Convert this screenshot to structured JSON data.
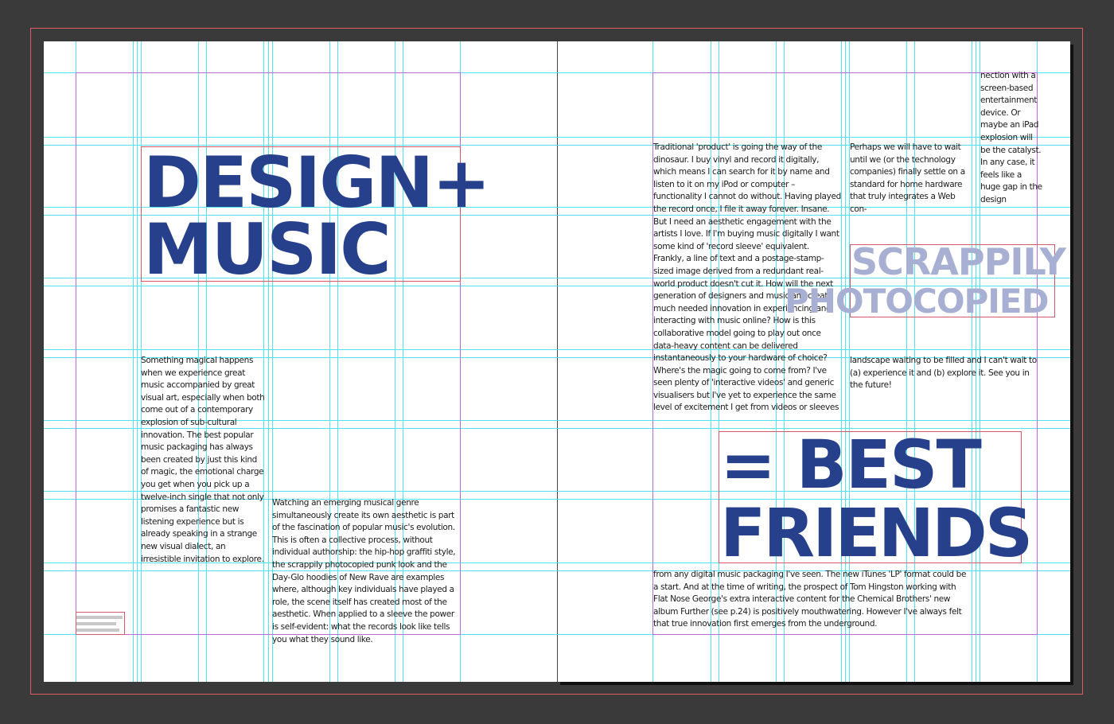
{
  "spread": {
    "left_page": {
      "headline_line1": "DESIGN+",
      "headline_line2": "MUSIC",
      "column1": "Something magical happens when we experience great music accompanied by great visual art, especially when both come out of a contemporary explosion of sub-cultural innovation. The best popular music packaging has always been created by just this kind of magic, the emotional charge you get when you pick up a twelve-inch single that not only promises a fantastic new listening experience but is already speaking in a strange new visual dialect, an irresistible invitation to explore.",
      "column2": "Watching an emerging musical genre simultaneously create its own aesthetic is part of the fascination of popular music's evolution. This is often a collective process, without individual authorship: the hip-hop graffiti style, the scrappily photocopied punk look and the Day-Glo hoodies of New Rave are examples where, although key individuals have played a role, the scene itself has created most of the aesthetic. When applied to a sleeve the power is self-evident: what the records look like tells you what they sound like."
    },
    "right_page": {
      "column1": "Traditional 'product' is going the way of the dinosaur. I buy vinyl and record it digitally, which means I can search for it by name and listen to it on my iPod or computer – functionality I cannot do without. Having played the record once, I file it away forever. Insane. But I need an aesthetic engagement with the artists I love. If I'm buying music digitally I want some kind of 'record sleeve' equivalent. Frankly, a line of text and a postage-stamp-sized image derived from a redundant real-world product doesn't cut it. How will the next generation of designers and musicians create much needed innovation in experiencing and interacting with music online? How is this collaborative model going to play out once data-heavy content can be delivered instantaneously to your hardware of choice? Where's the magic going to come from? I've seen plenty of 'interactive videos' and generic visualisers but I've yet to experience the same level of excitement I get from videos or sleeves",
      "column2": "Perhaps we will have to wait until we (or the technology companies) finally settle on a standard for home hardware that truly integrates a Web con-",
      "column3": "nection with a screen-based entertainment device. Or maybe an iPad explosion will be the catalyst. In any case, it feels like a huge gap in the design",
      "pull_quote_line1": "SCRAPPILY",
      "pull_quote_line2": "PHOTOCOPIED",
      "continuation": "landscape waiting to be filled and I can't wait to (a) experience it and (b) explore it. See you in the future!",
      "headline_line1": "= BEST",
      "headline_line2": "FRIENDS",
      "bottom_text": "from any digital music packaging I've seen. The new iTunes 'LP' format could be a start. And at the time of writing, the prospect of Tom Hingston working with Flat Nose George's extra interactive content for the Chemical Brothers' new album Further (see p.24) is positively mouthwatering. However I've always felt that true innovation first emerges from the underground."
    }
  },
  "colors": {
    "pasteboard": "#3a3a3a",
    "page": "#ffffff",
    "headline": "#27408b",
    "pull_quote": "#a7b0d3",
    "guide": "#3fe0ea",
    "bleed": "#e05a64",
    "margin": "#b86bd6"
  }
}
